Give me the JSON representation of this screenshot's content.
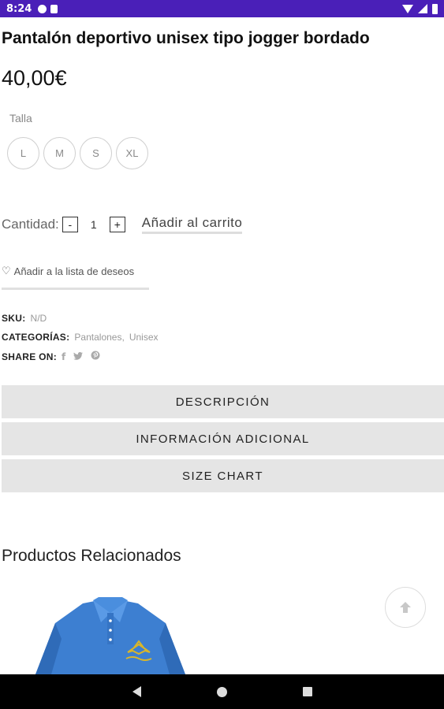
{
  "status_bar": {
    "time": "8:24"
  },
  "product": {
    "title": "Pantalón deportivo unisex tipo jogger bordado",
    "price": "40,00€"
  },
  "size_selector": {
    "label": "Talla",
    "options": [
      "L",
      "M",
      "S",
      "XL"
    ]
  },
  "quantity": {
    "label": "Cantidad:",
    "minus": "-",
    "value": "1",
    "plus": "+",
    "add_to_cart": "Añadir al carrito"
  },
  "wishlist": {
    "label": "Añadir a la lista de deseos",
    "icon": "heart-icon"
  },
  "meta": {
    "sku_label": "SKU:",
    "sku_value": "N/D",
    "categories_label": "CATEGORÍAS:",
    "categories": [
      "Pantalones",
      "Unisex"
    ],
    "categories_separator": ",",
    "share_label": "SHARE ON:",
    "share_icons": [
      "facebook-icon",
      "twitter-icon",
      "pinterest-icon"
    ]
  },
  "accordions": [
    {
      "label": "DESCRIPCIÓN"
    },
    {
      "label": "INFORMACIÓN ADICIONAL"
    },
    {
      "label": "SIZE CHART"
    }
  ],
  "related": {
    "title": "Productos Relacionados"
  },
  "colors": {
    "status_bar": "#4a1fb8",
    "accordion_bg": "#e5e5e5",
    "shirt_blue": "#3d7fd1",
    "embroidery": "#d9b62a"
  }
}
